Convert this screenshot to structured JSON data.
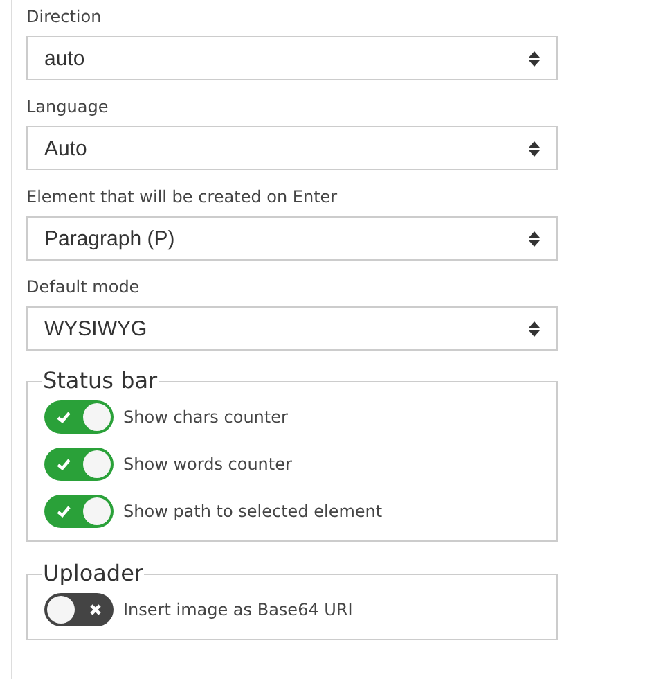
{
  "selects": [
    {
      "label": "Direction",
      "value": "auto"
    },
    {
      "label": "Language",
      "value": "Auto"
    },
    {
      "label": "Element that will be created on Enter",
      "value": "Paragraph (P)"
    },
    {
      "label": "Default mode",
      "value": "WYSIWYG"
    }
  ],
  "groups": [
    {
      "legend": "Status bar",
      "options": [
        {
          "label": "Show chars counter",
          "on": true
        },
        {
          "label": "Show words counter",
          "on": true
        },
        {
          "label": "Show path to selected element",
          "on": true
        }
      ]
    },
    {
      "legend": "Uploader",
      "options": [
        {
          "label": "Insert image as Base64 URI",
          "on": false
        }
      ]
    }
  ]
}
